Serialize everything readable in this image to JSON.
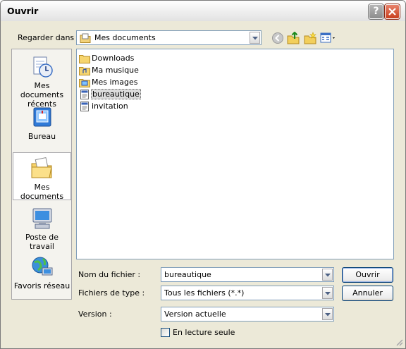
{
  "window": {
    "title": "Ouvrir"
  },
  "look_in": {
    "label": "Regarder dans :",
    "value": "Mes documents"
  },
  "toolbar": {
    "icons": [
      "back-icon",
      "up-folder-icon",
      "new-folder-icon",
      "view-menu-icon"
    ]
  },
  "places": [
    {
      "label": "Mes documents récents",
      "icon": "recent-documents-icon"
    },
    {
      "label": "Bureau",
      "icon": "desktop-icon"
    },
    {
      "label": "Mes documents",
      "icon": "my-documents-icon",
      "selected": true
    },
    {
      "label": "Poste de travail",
      "icon": "my-computer-icon"
    },
    {
      "label": "Favoris réseau",
      "icon": "network-places-icon"
    }
  ],
  "files": [
    {
      "name": "Downloads",
      "type": "folder"
    },
    {
      "name": "Ma musique",
      "type": "folder-special"
    },
    {
      "name": "Mes images",
      "type": "folder-special"
    },
    {
      "name": "bureautique",
      "type": "document",
      "selected": true
    },
    {
      "name": "invitation",
      "type": "document"
    }
  ],
  "filename": {
    "label": "Nom du fichier :",
    "value": "bureautique"
  },
  "filetype": {
    "label": "Fichiers de type :",
    "value": "Tous les fichiers (*.*)"
  },
  "version": {
    "label": "Version :",
    "value": "Version actuelle"
  },
  "buttons": {
    "open": "Ouvrir",
    "cancel": "Annuler"
  },
  "readonly": {
    "label": "En lecture seule",
    "checked": false
  },
  "colors": {
    "selection": "#dcdcdc",
    "window_bg": "#ece9d8",
    "field_border": "#7f9db9",
    "close_button": "#c8401f"
  }
}
